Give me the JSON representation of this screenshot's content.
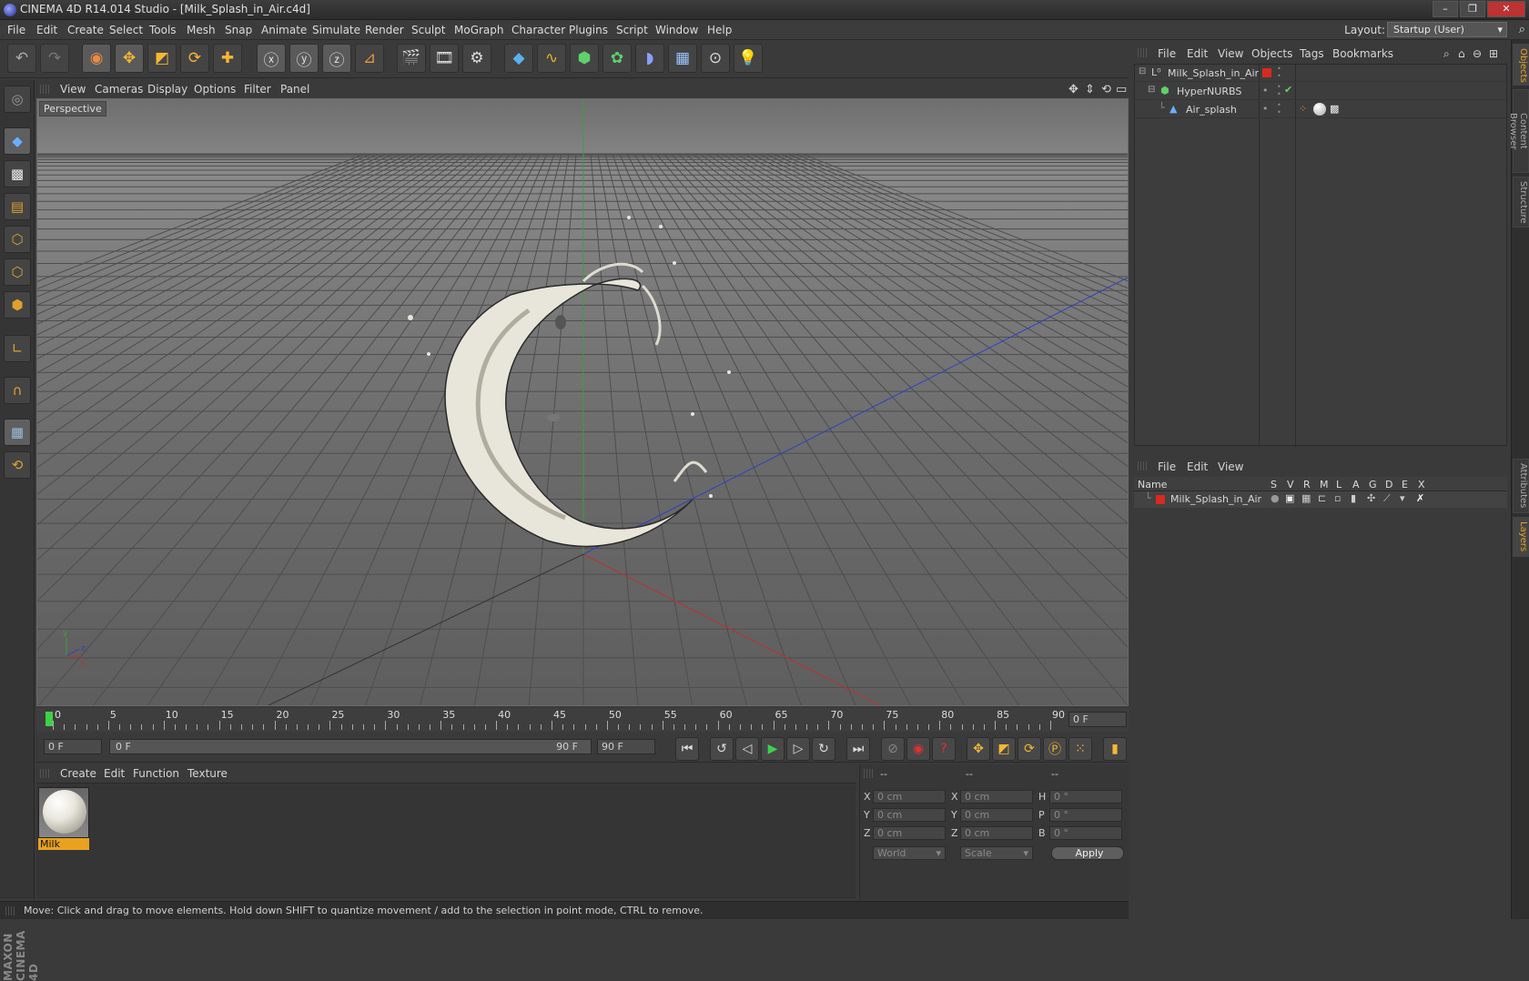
{
  "window": {
    "title": "CINEMA 4D R14.014 Studio - [Milk_Splash_in_Air.c4d]",
    "controls": [
      "–",
      "❐",
      "✕"
    ]
  },
  "menubar": {
    "items": [
      "File",
      "Edit",
      "Create",
      "Select",
      "Tools",
      "Mesh",
      "Snap",
      "Animate",
      "Simulate",
      "Render",
      "Sculpt",
      "MoGraph",
      "Character",
      "Plugins",
      "Script",
      "Window",
      "Help"
    ],
    "layout_label": "Layout:",
    "layout_value": "Startup (User)"
  },
  "viewport": {
    "menu": [
      "View",
      "Cameras",
      "Display",
      "Options",
      "Filter",
      "Panel"
    ],
    "label": "Perspective",
    "axis_labels": {
      "y": "y",
      "z": "z",
      "x": "x"
    }
  },
  "timeline": {
    "ticks": [
      "0",
      "5",
      "10",
      "15",
      "20",
      "25",
      "30",
      "35",
      "40",
      "45",
      "50",
      "55",
      "60",
      "65",
      "70",
      "75",
      "80",
      "85",
      "90"
    ],
    "current_frame": "0 F",
    "start_field": "0 F",
    "range_start": "0 F",
    "range_end": "90 F",
    "end_field": "90 F"
  },
  "material_manager": {
    "menu": [
      "Create",
      "Edit",
      "Function",
      "Texture"
    ],
    "material_name": "Milk"
  },
  "coordinates": {
    "headers": [
      "--",
      "--",
      "--"
    ],
    "rows": [
      {
        "a": "X",
        "av": "0 cm",
        "b": "X",
        "bv": "0 cm",
        "c": "H",
        "cv": "0 °"
      },
      {
        "a": "Y",
        "av": "0 cm",
        "b": "Y",
        "bv": "0 cm",
        "c": "P",
        "cv": "0 °"
      },
      {
        "a": "Z",
        "av": "0 cm",
        "b": "Z",
        "bv": "0 cm",
        "c": "B",
        "cv": "0 °"
      }
    ],
    "mode1": "World",
    "mode2": "Scale",
    "apply": "Apply"
  },
  "status": "Move: Click and drag to move elements. Hold down SHIFT to quantize movement / add to the selection in point mode, CTRL to remove.",
  "object_manager": {
    "menu": [
      "File",
      "Edit",
      "View",
      "Objects",
      "Tags",
      "Bookmarks"
    ],
    "objects": [
      "Milk_Splash_in_Air",
      "HyperNURBS",
      "Air_splash"
    ]
  },
  "layer_manager": {
    "menu": [
      "File",
      "Edit",
      "View"
    ],
    "columns": [
      "Name",
      "S",
      "V",
      "R",
      "M",
      "L",
      "A",
      "G",
      "D",
      "E",
      "X"
    ],
    "layer_name": "Milk_Splash_in_Air"
  },
  "side_tabs": [
    "Objects",
    "Content Browser",
    "Structure",
    "Attributes",
    "Layers"
  ],
  "branding": "MAXON CINEMA 4D",
  "colors": {
    "accent": "#e8a220",
    "layer_red": "#d82a1e",
    "play_green": "#3fd04a"
  }
}
